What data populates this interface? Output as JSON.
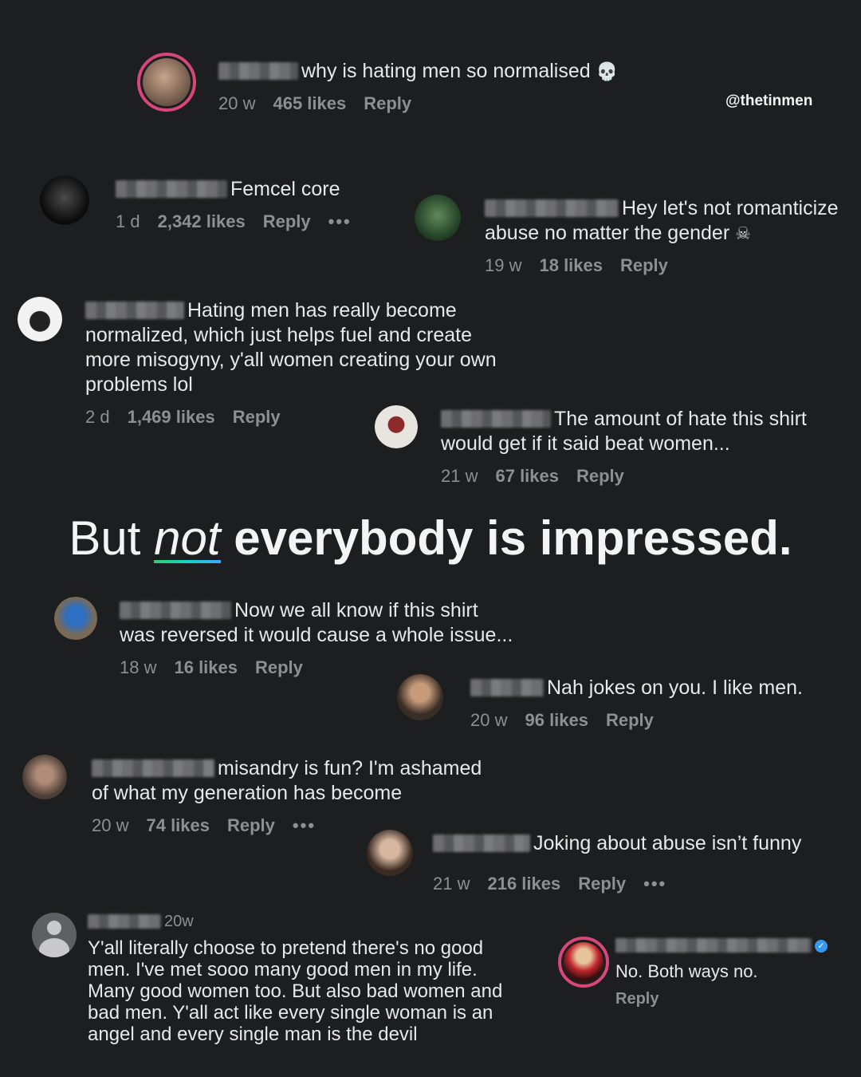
{
  "watermark": "@thetinmen",
  "headline": {
    "part1": "But",
    "emphasis": "not",
    "part2": "everybody is impressed."
  },
  "comments": [
    {
      "text": "why is hating men so normalised",
      "emoji": "💀",
      "time": "20 w",
      "likes": "465 likes",
      "reply": "Reply"
    },
    {
      "text": "Femcel core",
      "time": "1 d",
      "likes": "2,342 likes",
      "reply": "Reply",
      "more": "•••"
    },
    {
      "text": "Hey let's not romanticize abuse no matter the gender",
      "emoji": "☠",
      "time": "19 w",
      "likes": "18 likes",
      "reply": "Reply"
    },
    {
      "text": "Hating men has really become normalized, which just helps fuel and create more misogyny, y'all women creating your own problems lol",
      "time": "2 d",
      "likes": "1,469 likes",
      "reply": "Reply"
    },
    {
      "text": "The amount of hate this shirt would get if it said beat women...",
      "time": "21 w",
      "likes": "67 likes",
      "reply": "Reply"
    },
    {
      "text": "Now we all know if this shirt was reversed it would cause a whole issue...",
      "time": "18 w",
      "likes": "16 likes",
      "reply": "Reply"
    },
    {
      "text": "Nah jokes on you. I like men.",
      "time": "20 w",
      "likes": "96 likes",
      "reply": "Reply"
    },
    {
      "text": "misandry is fun? I'm ashamed of what my generation has become",
      "time": "20 w",
      "likes": "74 likes",
      "reply": "Reply",
      "more": "•••"
    },
    {
      "text": "Joking about abuse isn’t funny",
      "time": "21 w",
      "likes": "216 likes",
      "reply": "Reply",
      "more": "•••"
    },
    {
      "time": "20w",
      "text": "Y'all literally choose to pretend there's no good men. I've met sooo many good men in my life. Many good women too. But also bad women and bad men. Y'all act like every single woman is an angel and every single man is the devil"
    },
    {
      "text": "No. Both ways no.",
      "reply": "Reply"
    }
  ]
}
